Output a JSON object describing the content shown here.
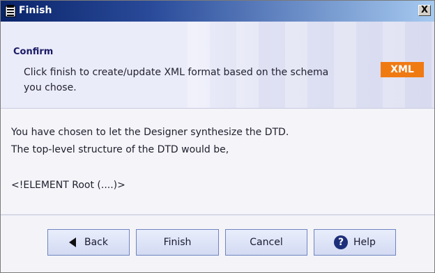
{
  "window": {
    "title": "Finish",
    "close_label": "X"
  },
  "header": {
    "title": "Confirm",
    "description": "Click finish to create/update XML format based on the schema you chose.",
    "badge": "XML",
    "badge_color": "#f07a12"
  },
  "content": {
    "line1": "You have chosen to let the Designer synthesize the DTD.",
    "line2": "The top-level structure of the DTD would be,",
    "line3": "<!ELEMENT Root (....)>"
  },
  "buttons": {
    "back": "Back",
    "finish": "Finish",
    "cancel": "Cancel",
    "help": "Help",
    "help_icon_glyph": "?"
  },
  "icons": {
    "title": "app-icon",
    "back": "back-arrow-icon",
    "help": "help-icon"
  }
}
